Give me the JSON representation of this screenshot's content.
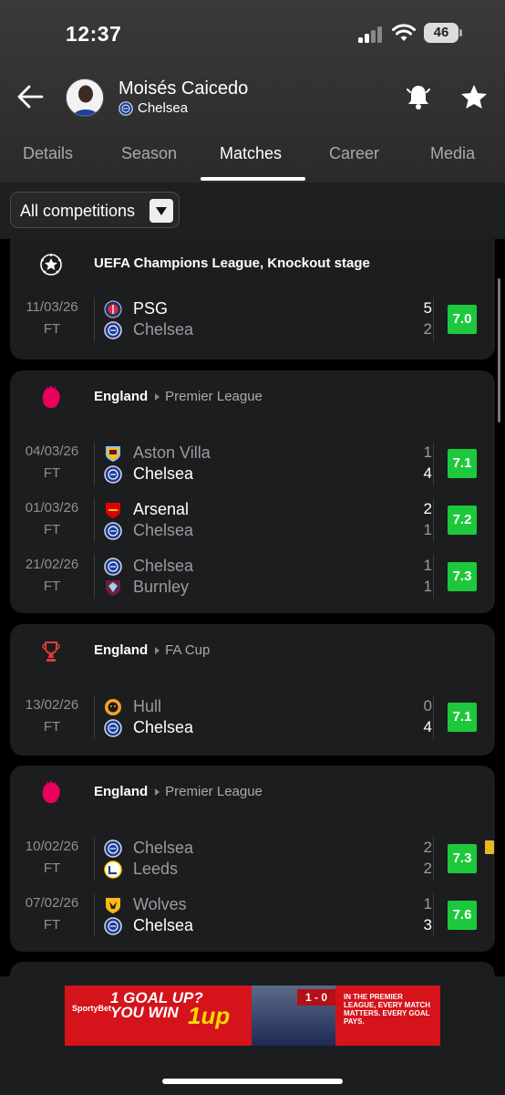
{
  "status": {
    "time": "12:37",
    "battery": "46"
  },
  "player": {
    "name": "Moisés Caicedo",
    "club": "Chelsea"
  },
  "tabs": [
    {
      "label": "Details"
    },
    {
      "label": "Season"
    },
    {
      "label": "Matches",
      "active": true
    },
    {
      "label": "Career"
    },
    {
      "label": "Media"
    }
  ],
  "filter": {
    "selected": "All competitions"
  },
  "colors": {
    "rating_green": "#1ec83c",
    "card_bg": "#1c1d1f",
    "yellow_card": "#e6b91e",
    "premier_league": "#e8005a"
  },
  "groups": [
    {
      "country": "",
      "competition": "UEFA Champions League, Knockout stage",
      "icon": "champions-league-icon",
      "matches": [
        {
          "date": "11/03/26",
          "status": "FT",
          "home": "PSG",
          "away": "Chelsea",
          "home_score": "5",
          "away_score": "2",
          "rating": "7.0"
        }
      ]
    },
    {
      "country": "England",
      "competition": "Premier League",
      "icon": "premier-league-icon",
      "matches": [
        {
          "date": "04/03/26",
          "status": "FT",
          "home": "Aston Villa",
          "away": "Chelsea",
          "home_score": "1",
          "away_score": "4",
          "rating": "7.1"
        },
        {
          "date": "01/03/26",
          "status": "FT",
          "home": "Arsenal",
          "away": "Chelsea",
          "home_score": "2",
          "away_score": "1",
          "rating": "7.2"
        },
        {
          "date": "21/02/26",
          "status": "FT",
          "home": "Chelsea",
          "away": "Burnley",
          "home_score": "1",
          "away_score": "1",
          "rating": "7.3"
        }
      ]
    },
    {
      "country": "England",
      "competition": "FA Cup",
      "icon": "fa-cup-icon",
      "matches": [
        {
          "date": "13/02/26",
          "status": "FT",
          "home": "Hull",
          "away": "Chelsea",
          "home_score": "0",
          "away_score": "4",
          "rating": "7.1"
        }
      ]
    },
    {
      "country": "England",
      "competition": "Premier League",
      "icon": "premier-league-icon",
      "matches": [
        {
          "date": "10/02/26",
          "status": "FT",
          "home": "Chelsea",
          "away": "Leeds",
          "home_score": "2",
          "away_score": "2",
          "rating": "7.3",
          "yellow_card": true
        },
        {
          "date": "07/02/26",
          "status": "FT",
          "home": "Wolves",
          "away": "Chelsea",
          "home_score": "1",
          "away_score": "3",
          "rating": "7.6"
        }
      ]
    }
  ],
  "ad": {
    "brand": "SportyBet",
    "headline_1": "1 GOAL UP?",
    "headline_2": "YOU WIN",
    "product": "1up",
    "score": "1 - 0",
    "tagline": "IN THE PREMIER LEAGUE, EVERY MATCH MATTERS. EVERY GOAL PAYS."
  }
}
